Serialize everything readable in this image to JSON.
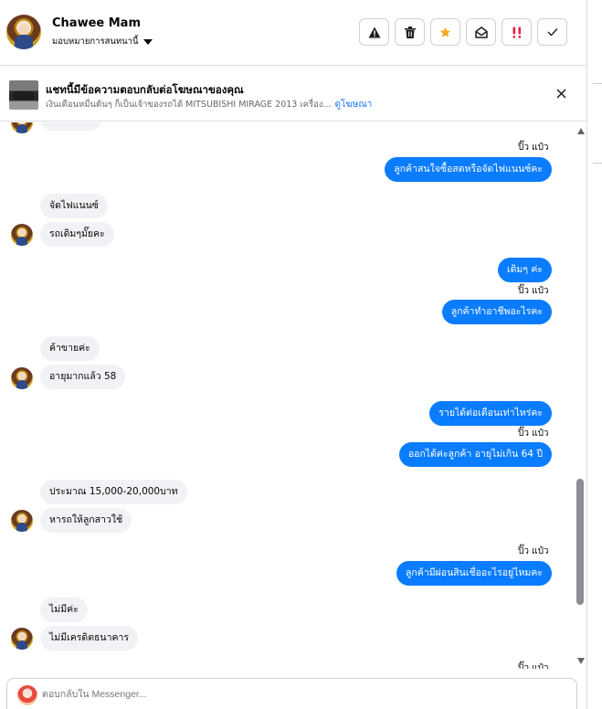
{
  "header": {
    "name": "Chawee Mam",
    "assign_label": "มอบหมายการสนทนานี้",
    "actions": [
      {
        "icon": "warning-icon"
      },
      {
        "icon": "trash-icon"
      },
      {
        "icon": "star-icon",
        "color": "#f5a623"
      },
      {
        "icon": "mail-open-icon"
      },
      {
        "icon": "follow-up-icon",
        "color": "#e41e3f"
      },
      {
        "icon": "check-icon"
      }
    ]
  },
  "ad_banner": {
    "title": "แชทนี้มีข้อความตอบกลับต่อโฆษณาของคุณ",
    "subtitle": "เงินเดือนหมื่นต้นๆ ก็เป็นเจ้าของรถได้ MITSUBISHI MIRAGE 2013 เครื่อง...",
    "link": "ดูโฆษณา"
  },
  "messages": [
    {
      "type": "seen",
      "text": "ปิ๊ว แป๋ว"
    },
    {
      "type": "out",
      "text": "ลูกค้าสนใจซื้อสดหรือจัดไฟแนนซ์คะ"
    },
    {
      "type": "in",
      "text": "จัดไฟแนนซ์"
    },
    {
      "type": "in",
      "text": "รถเดิมๆมั๊ยคะ"
    },
    {
      "type": "out",
      "text": "เดิมๆ ค่ะ"
    },
    {
      "type": "seen",
      "text": "ปิ๊ว แป๋ว"
    },
    {
      "type": "out",
      "text": "ลูกค้าทำอาชีพอะไรคะ"
    },
    {
      "type": "in",
      "text": "ค้าขายค่ะ"
    },
    {
      "type": "in",
      "text": "อายุมากแล้ว 58"
    },
    {
      "type": "out",
      "text": "รายได้ต่อเดือนเท่าไหร่คะ"
    },
    {
      "type": "seen",
      "text": "ปิ๊ว แป๋ว"
    },
    {
      "type": "out",
      "text": "ออกได้ค่ะลูกค้า อายุไม่เกิน 64 ปี"
    },
    {
      "type": "in",
      "text": "ประมาณ 15,000-20,000บาท"
    },
    {
      "type": "in",
      "text": "หารถให้ลูกสาวใช้"
    },
    {
      "type": "seen",
      "text": "ปิ๊ว แป๋ว"
    },
    {
      "type": "out",
      "text": "ลูกค้ามีผ่อนสินเชื่ออะไรอยู่ไหมคะ"
    },
    {
      "type": "in",
      "text": "ไม่มีค่ะ"
    },
    {
      "type": "in",
      "text": "ไม่มีเครดิตธนาคาร"
    },
    {
      "type": "seen",
      "text": "ปิ๊ว แป๋ว"
    }
  ],
  "composer": {
    "placeholder": "ตอบกลับใน Messenger..."
  },
  "colors": {
    "outgoing_bubble": "#0a7cff",
    "incoming_bubble": "#f0f2f5",
    "link": "#1877f2"
  }
}
